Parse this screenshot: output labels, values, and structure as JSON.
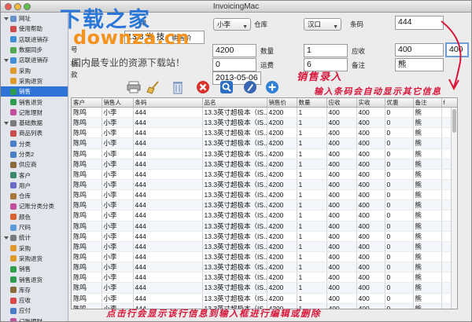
{
  "window": {
    "title": "InvoicingMac"
  },
  "sidebar": {
    "items": [
      {
        "label": "网址",
        "level": 0,
        "color": "#6b8fc7",
        "icon": "globe-icon"
      },
      {
        "label": "使用帮助",
        "level": 1,
        "color": "#d04a4a",
        "icon": "help-icon"
      },
      {
        "label": "店联进销存",
        "level": 1,
        "color": "#3f8fd8",
        "icon": "store-icon"
      },
      {
        "label": "数据同步",
        "level": 1,
        "color": "#52a84f",
        "icon": "sync-icon"
      },
      {
        "label": "店联进销存",
        "level": 0,
        "color": "#3f8fd8",
        "icon": "store-icon"
      },
      {
        "label": "采购",
        "level": 1,
        "color": "#e09a2c",
        "icon": "purchase-icon"
      },
      {
        "label": "采购退货",
        "level": 1,
        "color": "#e09a2c",
        "icon": "purchase-return-icon"
      },
      {
        "label": "销售",
        "level": 1,
        "color": "#2f9d4e",
        "icon": "sales-icon",
        "selected": true
      },
      {
        "label": "销售退货",
        "level": 1,
        "color": "#2f9d4e",
        "icon": "sales-return-icon"
      },
      {
        "label": "记账理财",
        "level": 1,
        "color": "#c24f9c",
        "icon": "finance-icon"
      },
      {
        "label": "基础数据",
        "level": 0,
        "color": "#7a7a7a",
        "icon": "database-icon"
      },
      {
        "label": "商品列表",
        "level": 1,
        "color": "#c84a4a",
        "icon": "product-list-icon"
      },
      {
        "label": "分类",
        "level": 1,
        "color": "#4a7fc8",
        "icon": "category-icon"
      },
      {
        "label": "分类2",
        "level": 1,
        "color": "#4a7fc8",
        "icon": "category2-icon"
      },
      {
        "label": "供应商",
        "level": 1,
        "color": "#8a6a3a",
        "icon": "supplier-icon"
      },
      {
        "label": "客户",
        "level": 1,
        "color": "#3a8a6a",
        "icon": "customer-icon"
      },
      {
        "label": "用户",
        "level": 1,
        "color": "#6a6ac8",
        "icon": "user-icon"
      },
      {
        "label": "仓库",
        "level": 1,
        "color": "#a8783a",
        "icon": "warehouse-icon"
      },
      {
        "label": "记账分类分类",
        "level": 1,
        "color": "#c24f9c",
        "icon": "ledger-category-icon"
      },
      {
        "label": "颜色",
        "level": 1,
        "color": "#d8632f",
        "icon": "color-icon"
      },
      {
        "label": "尺码",
        "level": 1,
        "color": "#5a9ad8",
        "icon": "size-icon"
      },
      {
        "label": "统计",
        "level": 0,
        "color": "#7a7a7a",
        "icon": "stats-icon"
      },
      {
        "label": "采购",
        "level": 1,
        "color": "#e09a2c",
        "icon": "purchase-icon"
      },
      {
        "label": "采购退货",
        "level": 1,
        "color": "#e09a2c",
        "icon": "purchase-return-icon"
      },
      {
        "label": "销售",
        "level": 1,
        "color": "#2f9d4e",
        "icon": "sales-icon"
      },
      {
        "label": "销售退货",
        "level": 1,
        "color": "#2f9d4e",
        "icon": "sales-return-icon"
      },
      {
        "label": "库存",
        "level": 1,
        "color": "#8a6a3a",
        "icon": "inventory-icon"
      },
      {
        "label": "应收",
        "level": 1,
        "color": "#d84a4a",
        "icon": "receivable-icon"
      },
      {
        "label": "应付",
        "level": 1,
        "color": "#4a7fc8",
        "icon": "payable-icon"
      },
      {
        "label": "记账理财",
        "level": 1,
        "color": "#c24f9c",
        "icon": "finance-icon"
      }
    ]
  },
  "form": {
    "salesperson": {
      "value": "小李"
    },
    "warehouse": {
      "label": "仓库",
      "value": "汉口"
    },
    "barcode": {
      "label": "条码",
      "value": "444"
    },
    "product_name": {
      "value": "13.3 光 技"
    },
    "price_label": "销售价",
    "price": {
      "value": "4200"
    },
    "qty": {
      "label": "数量",
      "value": "1"
    },
    "receivable": {
      "label": "应收",
      "value": "400"
    },
    "actual": {
      "value": "400"
    },
    "discount": {
      "value": "0"
    },
    "freight": {
      "label": "运费",
      "value": "6"
    },
    "remark": {
      "label": "备注",
      "value": "熊"
    },
    "date": {
      "value": "2013-05-06"
    },
    "partial_labels": [
      "单",
      "号",
      "格",
      "款"
    ]
  },
  "toolbar": {
    "icons": [
      "printer-icon",
      "broom-icon",
      "trash-icon",
      "delete-icon",
      "search-icon",
      "edit-icon",
      "add-icon"
    ]
  },
  "grid": {
    "columns": [
      "客户",
      "销售人",
      "条码",
      "品名",
      "销售价",
      "数量",
      "应收",
      "实收",
      "优惠",
      "备注",
      "f"
    ],
    "rows": [
      [
        "陈鸣",
        "小李",
        "444",
        "13.3英寸超极本（IS...",
        "4200",
        "1",
        "400",
        "400",
        "0",
        "熊"
      ],
      [
        "陈鸣",
        "小李",
        "444",
        "13.3英寸超极本（IS...",
        "4200",
        "1",
        "400",
        "400",
        "0",
        "熊"
      ],
      [
        "陈鸣",
        "小李",
        "444",
        "13.3英寸超极本（IS...",
        "4200",
        "1",
        "400",
        "400",
        "0",
        "熊"
      ],
      [
        "陈鸣",
        "小李",
        "444",
        "13.3英寸超极本（IS...",
        "4200",
        "1",
        "400",
        "400",
        "0",
        "熊"
      ],
      [
        "陈鸣",
        "小李",
        "444",
        "13.3英寸超极本（IS...",
        "4200",
        "1",
        "400",
        "400",
        "0",
        "熊"
      ],
      [
        "陈鸣",
        "小李",
        "444",
        "13.3英寸超极本（IS...",
        "4200",
        "1",
        "400",
        "400",
        "0",
        "熊"
      ],
      [
        "陈鸣",
        "小李",
        "444",
        "13.3英寸超极本（IS...",
        "4200",
        "1",
        "400",
        "400",
        "0",
        "熊"
      ],
      [
        "陈鸣",
        "小李",
        "444",
        "13.3英寸超极本（IS...",
        "4200",
        "1",
        "400",
        "400",
        "0",
        "熊"
      ],
      [
        "陈鸣",
        "小李",
        "444",
        "13.3英寸超极本（IS...",
        "4200",
        "1",
        "400",
        "400",
        "0",
        "熊"
      ],
      [
        "陈鸣",
        "小李",
        "444",
        "13.3英寸超极本（IS...",
        "4200",
        "1",
        "400",
        "400",
        "0",
        "熊"
      ],
      [
        "陈鸣",
        "小李",
        "444",
        "13.3英寸超极本（IS...",
        "4200",
        "1",
        "400",
        "400",
        "0",
        "熊"
      ],
      [
        "陈鸣",
        "小李",
        "444",
        "13.3英寸超极本（IS...",
        "4200",
        "1",
        "400",
        "400",
        "0",
        "熊"
      ],
      [
        "陈鸣",
        "小李",
        "444",
        "13.3英寸超极本（IS...",
        "4200",
        "1",
        "400",
        "400",
        "0",
        "熊"
      ],
      [
        "陈鸣",
        "小李",
        "444",
        "13.3英寸超极本（IS...",
        "4200",
        "1",
        "400",
        "400",
        "0",
        "熊"
      ],
      [
        "陈鸣",
        "小李",
        "444",
        "13.3英寸超极本（IS...",
        "4200",
        "1",
        "400",
        "400",
        "0",
        "熊"
      ],
      [
        "陈鸣",
        "小李",
        "444",
        "13.3英寸超极本（IS...",
        "4200",
        "1",
        "400",
        "400",
        "0",
        "熊"
      ],
      [
        "陈鸣",
        "小李",
        "444",
        "13.3英寸超极本（IS...",
        "4200",
        "1",
        "400",
        "400",
        "0",
        "熊"
      ],
      [
        "陈鸣",
        "小李",
        "444",
        "13.3英寸超极本（IS...",
        "4200",
        "1",
        "400",
        "400",
        "0",
        "熊"
      ],
      [
        "陈鸣",
        "小李",
        "444",
        "13.3英寸超极本（IS...",
        "4200",
        "1",
        "400",
        "400",
        "0",
        "熊"
      ],
      [
        "陈鸣",
        "小李",
        "444",
        "13.3英寸超极本（IS...",
        "4200",
        "1",
        "400",
        "400",
        "0",
        "熊"
      ],
      [
        "陈鸣",
        "小李",
        "222",
        "T恤 雅思的云 蓝色 M...",
        "4200",
        "1",
        "400",
        "400",
        "0",
        "熊"
      ]
    ]
  },
  "annotations": {
    "sales_entry": "销售录入",
    "barcode_hint": "输入条码会自动显示其它信息",
    "click_row_hint": "点击行会显示该行信息到输入框进行编辑或删除"
  },
  "watermark": {
    "main": "下载之家",
    "sub": "downza.cn",
    "tagline": "国内最专业的资源下载站！"
  },
  "colors": {
    "annotation": "#d8163a",
    "selection": "#2f73d6",
    "watermark_blue": "#2b77d8",
    "watermark_orange": "#f4941f"
  }
}
